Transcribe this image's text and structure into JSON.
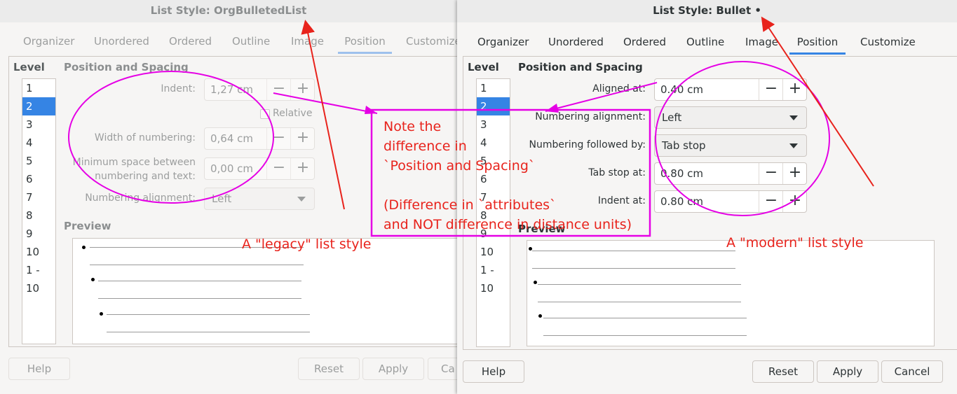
{
  "left_dialog": {
    "title": "List Style: OrgBulletedList",
    "tabs": [
      "Organizer",
      "Unordered",
      "Ordered",
      "Outline",
      "Image",
      "Position",
      "Customize"
    ],
    "level_heading": "Level",
    "levels": [
      "1",
      "2",
      "3",
      "4",
      "5",
      "6",
      "7",
      "8",
      "9",
      "10",
      "1 - 10"
    ],
    "section_title": "Position and Spacing",
    "indent_label": "Indent:",
    "indent_value": "1,27 cm",
    "relative_label": "Relative",
    "width_label": "Width of numbering:",
    "width_value": "0,64 cm",
    "minspace_label": "Minimum space between numbering and text:",
    "minspace_value": "0,00 cm",
    "align_label": "Numbering alignment:",
    "align_value": "Left",
    "preview_label": "Preview",
    "help": "Help",
    "reset": "Reset",
    "apply": "Apply",
    "cancel_partial": "Ca"
  },
  "right_dialog": {
    "title": "List Style: Bullet •",
    "tabs": [
      "Organizer",
      "Unordered",
      "Ordered",
      "Outline",
      "Image",
      "Position",
      "Customize"
    ],
    "level_heading": "Level",
    "levels": [
      "1",
      "2",
      "3",
      "4",
      "5",
      "6",
      "7",
      "8",
      "9",
      "10",
      "1 - 10"
    ],
    "section_title": "Position and Spacing",
    "aligned_label": "Aligned at:",
    "aligned_value": "0.40 cm",
    "align_label": "Numbering alignment:",
    "align_value": "Left",
    "followed_label": "Numbering followed by:",
    "followed_value": "Tab stop",
    "tabstop_label": "Tab stop at:",
    "tabstop_value": "0.80 cm",
    "indent_label": "Indent at:",
    "indent_value": "0.80 cm",
    "preview_label": "Preview",
    "help": "Help",
    "reset": "Reset",
    "apply": "Apply",
    "cancel": "Cancel"
  },
  "annotations": {
    "note_line1": "Note the",
    "note_line2": "difference in",
    "note_line3": "`Position and Spacing`",
    "note_line4": "(Difference in `attributes`",
    "note_line5": " and NOT difference in distance units)",
    "legacy": "A \"legacy\" list style",
    "modern": "A \"modern\" list style",
    "color": "#e8231c",
    "ellipse_color": "#e500e5"
  },
  "icons": {
    "minus": "−",
    "plus": "+"
  }
}
